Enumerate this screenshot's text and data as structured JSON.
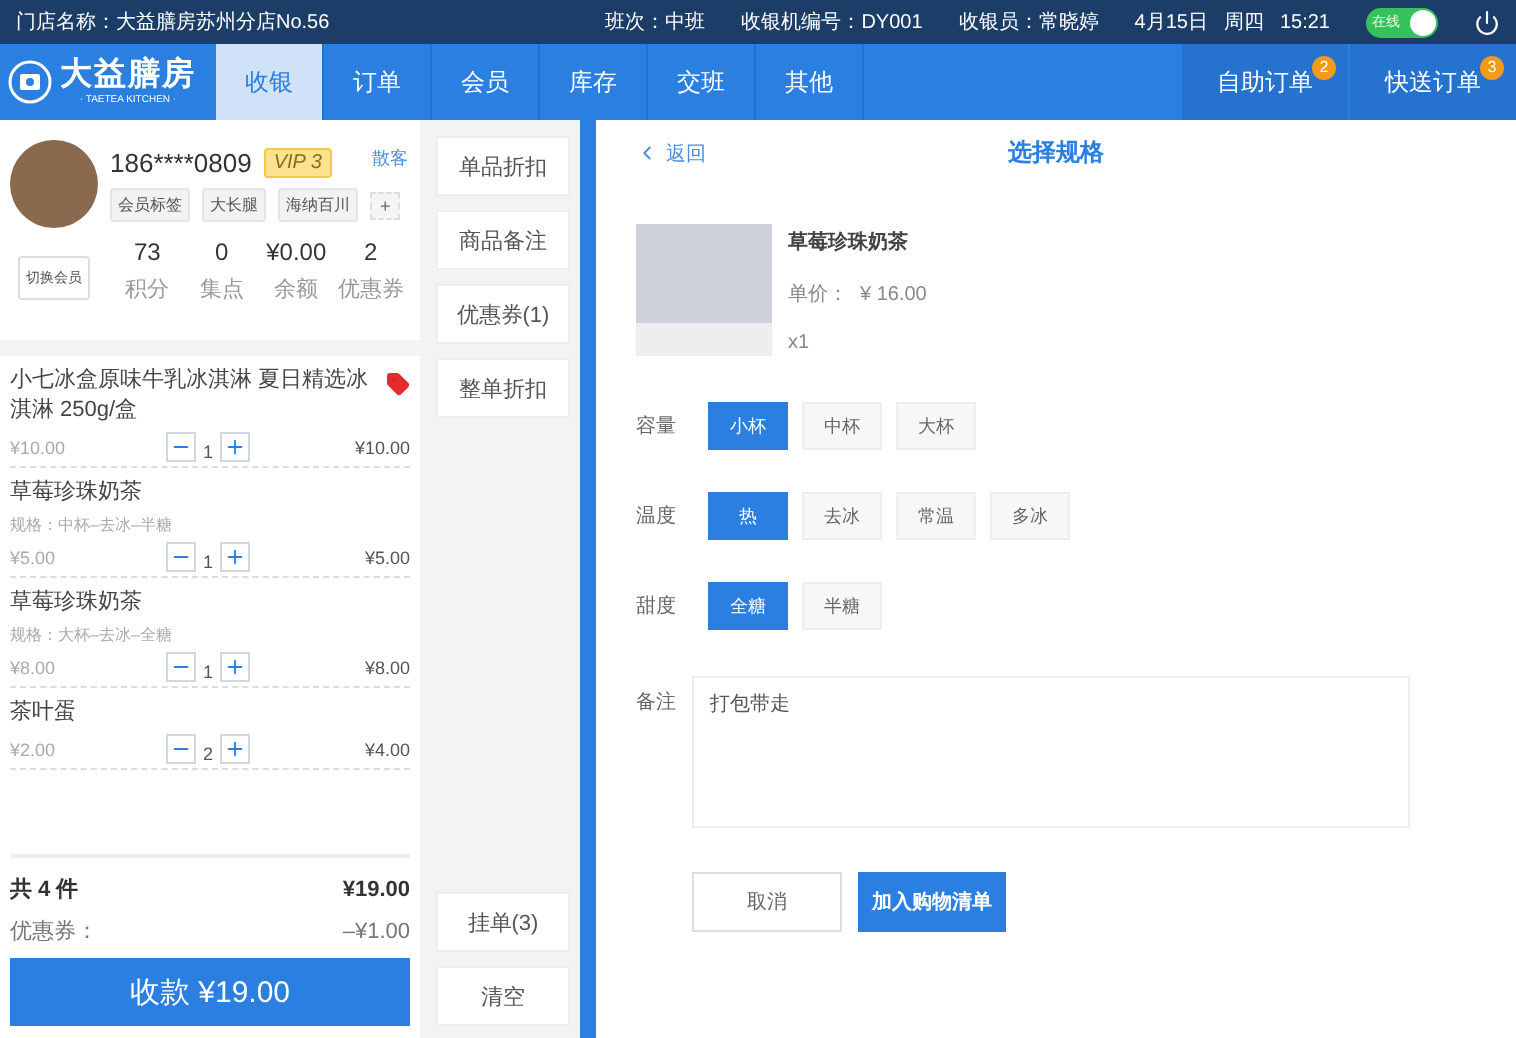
{
  "status_bar": {
    "store": "门店名称：大益膳房苏州分店No.56",
    "shift": "班次：中班",
    "register": "收银机编号：DY001",
    "cashier": "收银员：常晓婷",
    "date": "4月15日",
    "weekday": "周四",
    "time": "15:21",
    "online": {
      "label": "在线",
      "on": true
    }
  },
  "nav": {
    "logo": {
      "name": "大益膳房",
      "subtitle": "· TAETEA KITCHEN ·"
    },
    "tabs": [
      {
        "label": "收银",
        "selected": true
      },
      {
        "label": "订单",
        "selected": false
      },
      {
        "label": "会员",
        "selected": false
      },
      {
        "label": "库存",
        "selected": false
      },
      {
        "label": "交班",
        "selected": false
      },
      {
        "label": "其他",
        "selected": false
      }
    ],
    "order_tabs": [
      {
        "label": "自助订单",
        "badge": "2"
      },
      {
        "label": "快送订单",
        "badge": "3"
      }
    ]
  },
  "member": {
    "phone": "186****0809",
    "vip": "VIP 3",
    "guest": "散客",
    "tags": [
      "会员标签",
      "大长腿",
      "海纳百川"
    ],
    "add_tag": "+",
    "switch": "切换会员",
    "stats": [
      {
        "value": "73",
        "label": "积分"
      },
      {
        "value": "0",
        "label": "集点"
      },
      {
        "value": "¥0.00",
        "label": "余额"
      },
      {
        "value": "2",
        "label": "优惠券"
      }
    ]
  },
  "cart": [
    {
      "name": "小七冰盒原味牛乳冰淇淋  夏日精选冰淇淋  250g/盒",
      "tagged": true,
      "price": "¥10.00",
      "qty": "1",
      "total": "¥10.00"
    },
    {
      "name": "草莓珍珠奶茶",
      "spec": "规格：中杯–去冰–半糖",
      "tagged": false,
      "price": "¥5.00",
      "qty": "1",
      "total": "¥5.00"
    },
    {
      "name": "草莓珍珠奶茶",
      "spec": "规格：大杯–去冰–全糖",
      "tagged": false,
      "price": "¥8.00",
      "qty": "1",
      "total": "¥8.00"
    },
    {
      "name": "茶叶蛋",
      "tagged": false,
      "price": "¥2.00",
      "qty": "2",
      "total": "¥4.00"
    }
  ],
  "summary": {
    "count": "共 4 件",
    "subtotal": "¥19.00",
    "coupon_label": "优惠券：",
    "coupon_value": "–¥1.00",
    "pay": "收款 ¥19.00"
  },
  "actions": [
    "单品折扣",
    "商品备注",
    "优惠券(1)",
    "整单折扣"
  ],
  "bottom_actions": [
    "挂单(3)",
    "清空"
  ],
  "spec": {
    "back": "返回",
    "title": "选择规格",
    "product": {
      "name": "草莓珍珠奶茶",
      "price_label": "单价：",
      "price": "¥ 16.00",
      "qty": "x1"
    },
    "groups": [
      {
        "label": "容量",
        "options": [
          {
            "label": "小杯",
            "selected": true
          },
          {
            "label": "中杯",
            "selected": false
          },
          {
            "label": "大杯",
            "selected": false
          }
        ]
      },
      {
        "label": "温度",
        "options": [
          {
            "label": "热",
            "selected": true
          },
          {
            "label": "去冰",
            "selected": false
          },
          {
            "label": "常温",
            "selected": false
          },
          {
            "label": "多冰",
            "selected": false
          }
        ]
      },
      {
        "label": "甜度",
        "options": [
          {
            "label": "全糖",
            "selected": true
          },
          {
            "label": "半糖",
            "selected": false
          }
        ]
      }
    ],
    "note": {
      "label": "备注",
      "value": "打包带走"
    },
    "cancel": "取消",
    "confirm": "加入购物清单"
  }
}
